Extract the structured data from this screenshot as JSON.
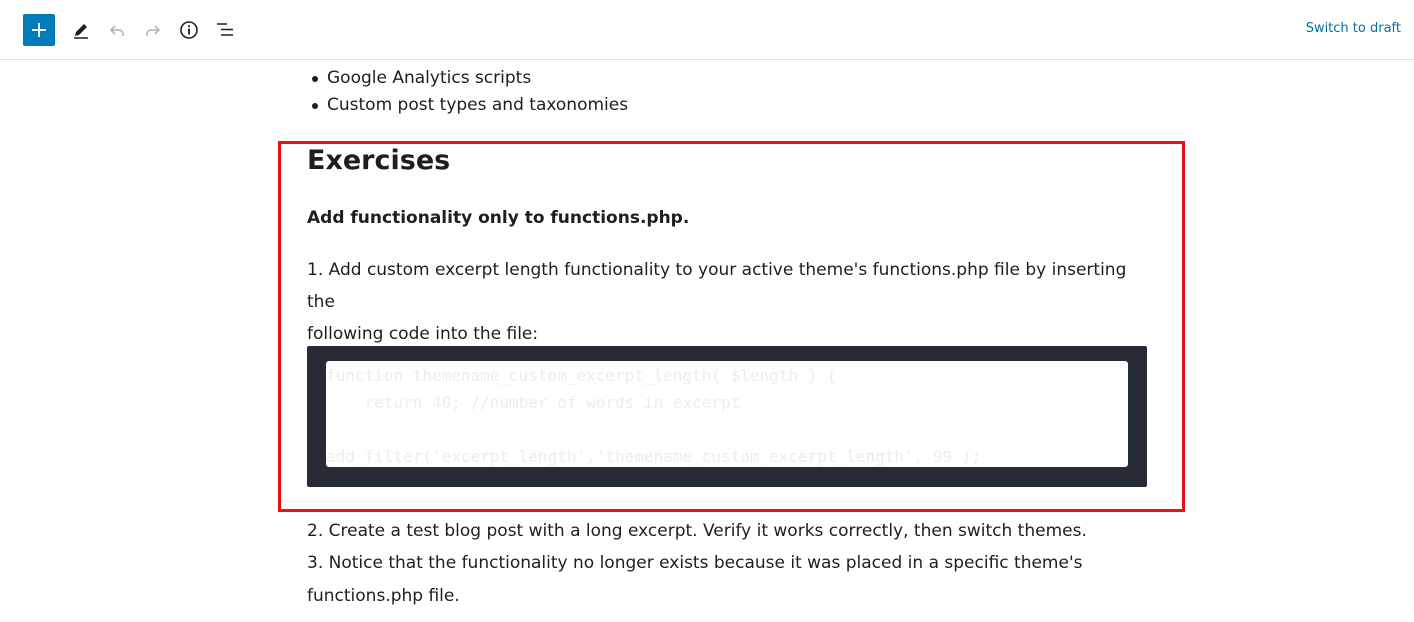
{
  "toolbar": {
    "add_icon": "plus-icon",
    "tools_icon": "pencil-icon",
    "undo_icon": "undo-icon",
    "redo_icon": "redo-icon",
    "details_icon": "info-icon",
    "outline_icon": "list-view-icon",
    "switch_label": "Switch to draft",
    "accent_color": "#007cba"
  },
  "content": {
    "bullets": [
      "Google Analytics scripts",
      "Custom post types and taxonomies"
    ],
    "heading": "Exercises",
    "subheading": "Add functionality only to functions.php.",
    "para1_line1": "1. Add custom excerpt length functionality to your active theme's functions.php file by inserting the",
    "para1_line2": "following code into the file:",
    "code_lines": [
      "function themename_custom_excerpt_length( $length ) {",
      "    return 40; //number of words in excerpt",
      "",
      "add_filter('excerpt_length','themename_custom_excerpt_length', 99 );"
    ],
    "step2": "2. Create a test blog post with a long excerpt. Verify it works correctly, then switch themes.",
    "step3_line1": "3. Notice that the functionality no longer exists because it was placed in a specific theme's",
    "step3_line2": "functions.php file.",
    "highlight_color": "#e8101a"
  }
}
